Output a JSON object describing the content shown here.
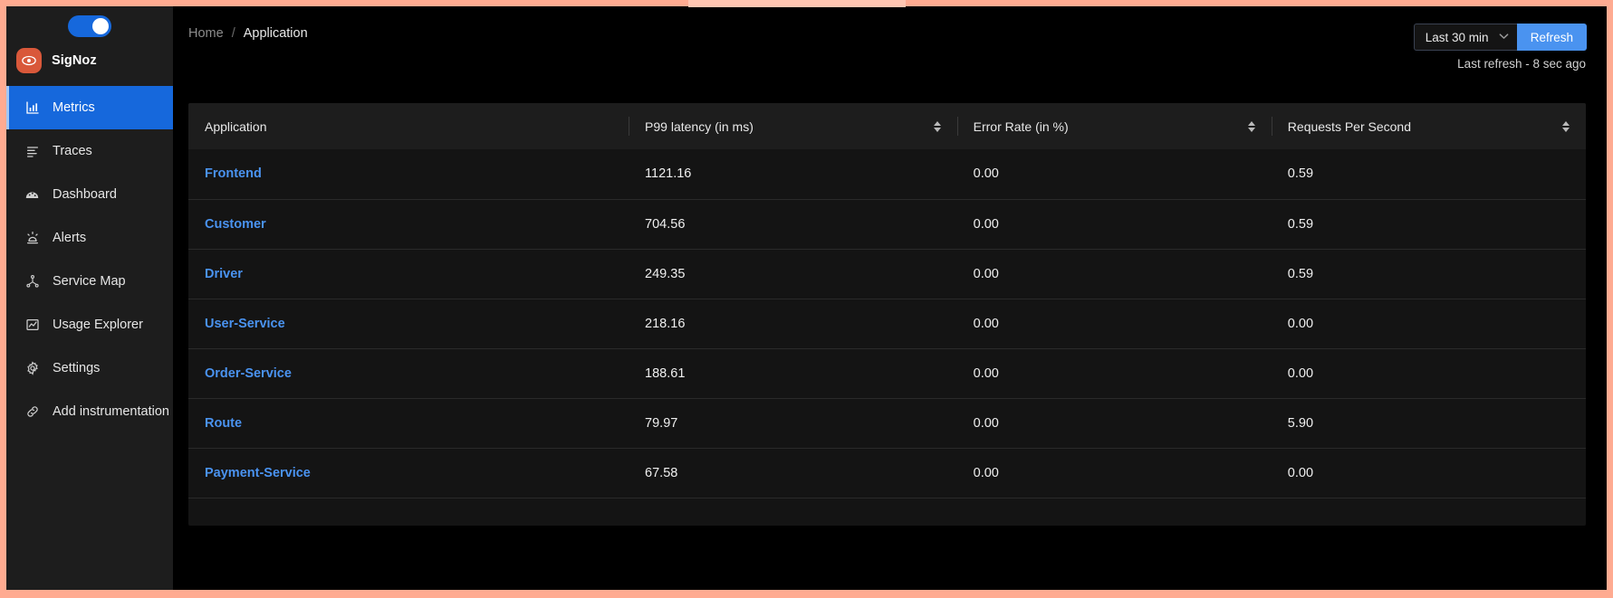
{
  "sidebar": {
    "theme_toggle": {
      "name": "dark-mode-toggle",
      "state": "on"
    },
    "brand": {
      "name": "SigNoz",
      "logo": "eye-icon",
      "color": "#d9583a"
    },
    "items": [
      {
        "label": "Metrics",
        "icon": "bar-chart-icon",
        "active": true
      },
      {
        "label": "Traces",
        "icon": "list-lines-icon",
        "active": false
      },
      {
        "label": "Dashboard",
        "icon": "gauge-icon",
        "active": false
      },
      {
        "label": "Alerts",
        "icon": "alarm-light-icon",
        "active": false
      },
      {
        "label": "Service Map",
        "icon": "node-graph-icon",
        "active": false
      },
      {
        "label": "Usage Explorer",
        "icon": "line-chart-icon",
        "active": false
      },
      {
        "label": "Settings",
        "icon": "gear-icon",
        "active": false
      },
      {
        "label": "Add instrumentation",
        "icon": "link-chain-icon",
        "active": false
      }
    ]
  },
  "header": {
    "breadcrumb": {
      "home": "Home",
      "separator": "/",
      "current": "Application"
    },
    "time_range": {
      "selected": "Last 30 min",
      "chevron": "chevron-down-icon"
    },
    "refresh_label": "Refresh",
    "last_refresh": "Last refresh - 8 sec ago"
  },
  "colors": {
    "accent_blue": "#4a93f0",
    "active_nav": "#1668dc",
    "brand_orange": "#d9583a",
    "page_border": "#ffab91",
    "surface": "#141414",
    "surface_alt": "#1d1d1d"
  },
  "table": {
    "columns": [
      {
        "label": "Application",
        "sortable": false
      },
      {
        "label": "P99 latency (in ms)",
        "sortable": true
      },
      {
        "label": "Error Rate (in %)",
        "sortable": true
      },
      {
        "label": "Requests Per Second",
        "sortable": true
      }
    ],
    "rows": [
      {
        "application": "Frontend",
        "p99_latency": "1121.16",
        "error_rate": "0.00",
        "requests_per_second": "0.59"
      },
      {
        "application": "Customer",
        "p99_latency": "704.56",
        "error_rate": "0.00",
        "requests_per_second": "0.59"
      },
      {
        "application": "Driver",
        "p99_latency": "249.35",
        "error_rate": "0.00",
        "requests_per_second": "0.59"
      },
      {
        "application": "User-Service",
        "p99_latency": "218.16",
        "error_rate": "0.00",
        "requests_per_second": "0.00"
      },
      {
        "application": "Order-Service",
        "p99_latency": "188.61",
        "error_rate": "0.00",
        "requests_per_second": "0.00"
      },
      {
        "application": "Route",
        "p99_latency": "79.97",
        "error_rate": "0.00",
        "requests_per_second": "5.90"
      },
      {
        "application": "Payment-Service",
        "p99_latency": "67.58",
        "error_rate": "0.00",
        "requests_per_second": "0.00"
      }
    ]
  }
}
